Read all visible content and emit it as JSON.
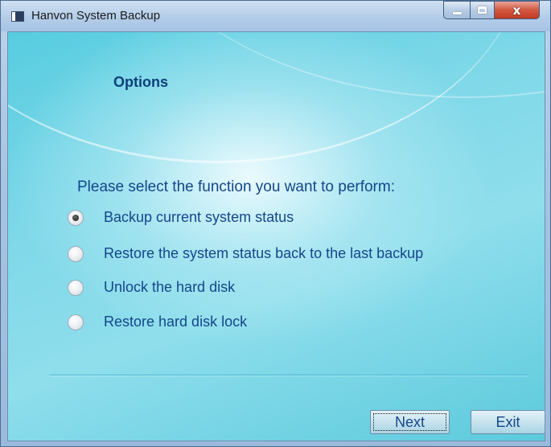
{
  "window": {
    "title": "Hanvon System Backup",
    "controls": {
      "minimize": "–",
      "maximize": "□",
      "close": "x"
    }
  },
  "page": {
    "heading": "Options",
    "prompt": "Please select the function you want to perform:",
    "options": [
      {
        "label": "Backup current system status",
        "checked": true
      },
      {
        "label": "Restore the system status back to the last backup",
        "checked": false
      },
      {
        "label": "Unlock the hard disk",
        "checked": false
      },
      {
        "label": "Restore hard disk lock",
        "checked": false
      }
    ]
  },
  "buttons": {
    "next": "Next",
    "exit": "Exit"
  },
  "colors": {
    "accent_text": "#14468a",
    "background": "#7fd8e8",
    "close_button": "#c23a22"
  }
}
